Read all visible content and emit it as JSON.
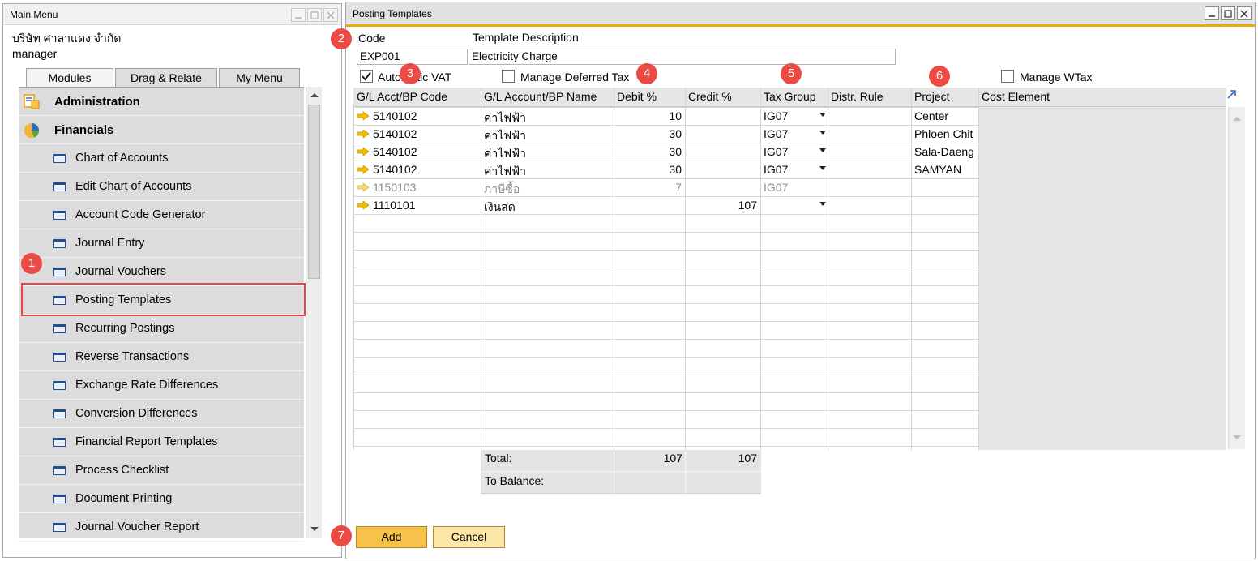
{
  "main_menu": {
    "title": "Main Menu",
    "company": "บริษัท ศาลาแดง จำกัด",
    "user": "manager",
    "tabs": [
      "Modules",
      "Drag & Relate",
      "My Menu"
    ],
    "top_items": [
      {
        "label": "Administration",
        "icon": "administration-icon"
      },
      {
        "label": "Financials",
        "icon": "financials-pie-icon"
      }
    ],
    "items": [
      "Chart of Accounts",
      "Edit Chart of Accounts",
      "Account Code Generator",
      "Journal Entry",
      "Journal Vouchers",
      "Posting Templates",
      "Recurring Postings",
      "Reverse Transactions",
      "Exchange Rate Differences",
      "Conversion Differences",
      "Financial Report Templates",
      "Process Checklist",
      "Document Printing",
      "Journal Voucher Report"
    ],
    "selected_item": "Posting Templates"
  },
  "posting_templates": {
    "title": "Posting Templates",
    "code_label": "Code",
    "code_value": "EXP001",
    "desc_label": "Template Description",
    "desc_value": "Electricity Charge",
    "auto_vat_label": "Automatic VAT",
    "auto_vat_checked": true,
    "deferred_tax_label": "Manage Deferred Tax",
    "deferred_tax_checked": false,
    "wtax_label": "Manage WTax",
    "wtax_checked": false,
    "columns": [
      "G/L Acct/BP Code",
      "G/L Account/BP Name",
      "Debit %",
      "Credit %",
      "Tax Group",
      "Distr. Rule",
      "Project",
      "Cost Element"
    ],
    "rows": [
      {
        "code": "5140102",
        "name": "ค่าไฟฟ้า",
        "debit": "10",
        "credit": "",
        "tax": "IG07",
        "distr": "",
        "project": "Center",
        "cost": "",
        "dimmed": false,
        "dropdown": true
      },
      {
        "code": "5140102",
        "name": "ค่าไฟฟ้า",
        "debit": "30",
        "credit": "",
        "tax": "IG07",
        "distr": "",
        "project": "Phloen Chit",
        "cost": "",
        "dimmed": false,
        "dropdown": true
      },
      {
        "code": "5140102",
        "name": "ค่าไฟฟ้า",
        "debit": "30",
        "credit": "",
        "tax": "IG07",
        "distr": "",
        "project": "Sala-Daeng",
        "cost": "",
        "dimmed": false,
        "dropdown": true
      },
      {
        "code": "5140102",
        "name": "ค่าไฟฟ้า",
        "debit": "30",
        "credit": "",
        "tax": "IG07",
        "distr": "",
        "project": "SAMYAN",
        "cost": "",
        "dimmed": false,
        "dropdown": true
      },
      {
        "code": "1150103",
        "name": "ภาษีซื้อ",
        "debit": "7",
        "credit": "",
        "tax": "IG07",
        "distr": "",
        "project": "",
        "cost": "",
        "dimmed": true,
        "dropdown": false
      },
      {
        "code": "1110101",
        "name": "เงินสด",
        "debit": "",
        "credit": "107",
        "tax": "",
        "distr": "",
        "project": "",
        "cost": "",
        "dimmed": false,
        "dropdown": true
      }
    ],
    "total_label": "Total:",
    "total_debit": "107",
    "total_credit": "107",
    "balance_label": "To Balance:",
    "add_label": "Add",
    "cancel_label": "Cancel"
  },
  "annotations": [
    "1",
    "2",
    "3",
    "4",
    "5",
    "6",
    "7"
  ],
  "colors": {
    "accent_orange": "#f0ab00",
    "badge_red": "#ec4b45",
    "highlight_red": "#e0464c",
    "arrow_yellow": "#f2c200",
    "button_yellow": "#f6c24a"
  }
}
